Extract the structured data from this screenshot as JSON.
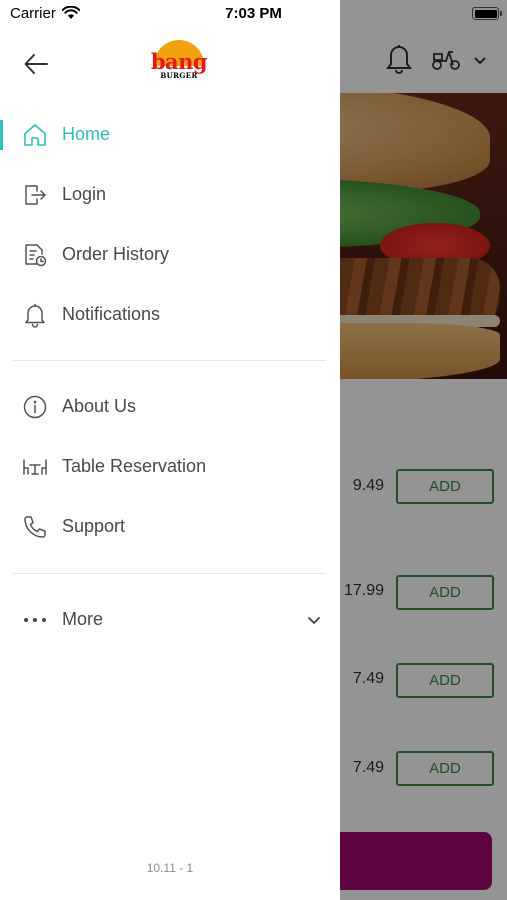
{
  "status_bar": {
    "carrier": "Carrier",
    "time": "7:03 PM"
  },
  "drawer": {
    "logo": {
      "word": "bang",
      "sub": "BURGER"
    },
    "primary_menu": [
      {
        "label": "Home",
        "icon": "home-icon",
        "active": true
      },
      {
        "label": "Login",
        "icon": "login-icon"
      },
      {
        "label": "Order History",
        "icon": "order-history-icon"
      },
      {
        "label": "Notifications",
        "icon": "bell-icon"
      }
    ],
    "secondary_menu": [
      {
        "label": "About Us",
        "icon": "info-icon"
      },
      {
        "label": "Table Reservation",
        "icon": "table-icon"
      },
      {
        "label": "Support",
        "icon": "phone-icon"
      }
    ],
    "more": {
      "label": "More",
      "icon": "more-dots-icon"
    },
    "version": "10.11 - 1"
  },
  "background": {
    "products": [
      {
        "price": "9.49",
        "add_label": "ADD"
      },
      {
        "price": "17.99",
        "add_label": "ADD"
      },
      {
        "price": "7.49",
        "add_label": "ADD"
      },
      {
        "price": "7.49",
        "add_label": "ADD"
      }
    ]
  },
  "colors": {
    "accent": "#2fc2b8",
    "add_green": "#3a8a45",
    "checkout": "#a10a6c",
    "logo_red": "#e01a1a",
    "logo_sun": "#f2a20f"
  }
}
